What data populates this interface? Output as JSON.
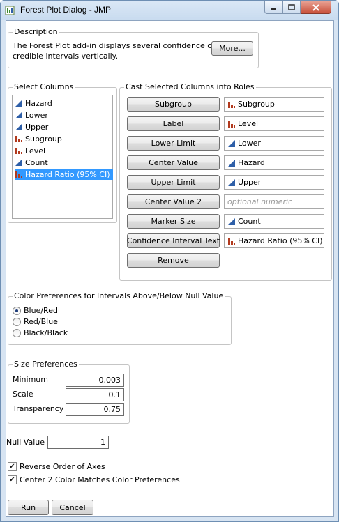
{
  "window": {
    "title": "Forest Plot Dialog - JMP"
  },
  "description": {
    "legend": "Description",
    "text_line1": "The Forest Plot add-in displays several confidence or",
    "text_line2": "credible intervals vertically.",
    "more_label": "More..."
  },
  "select_columns": {
    "legend": "Select Columns",
    "items": [
      {
        "label": "Hazard",
        "type": "continuous"
      },
      {
        "label": "Lower",
        "type": "continuous"
      },
      {
        "label": "Upper",
        "type": "continuous"
      },
      {
        "label": "Subgroup",
        "type": "nominal"
      },
      {
        "label": "Level",
        "type": "nominal"
      },
      {
        "label": "Count",
        "type": "continuous"
      },
      {
        "label": "Hazard Ratio (95% CI)",
        "type": "nominal",
        "selected": true
      }
    ]
  },
  "cast": {
    "legend": "Cast Selected Columns into Roles",
    "roles": [
      {
        "button": "Subgroup",
        "value": "Subgroup",
        "type": "nominal"
      },
      {
        "button": "Label",
        "value": "Level",
        "type": "nominal"
      },
      {
        "button": "Lower Limit",
        "value": "Lower",
        "type": "continuous"
      },
      {
        "button": "Center Value",
        "value": "Hazard",
        "type": "continuous"
      },
      {
        "button": "Upper Limit",
        "value": "Upper",
        "type": "continuous"
      },
      {
        "button": "Center Value 2",
        "value": "",
        "placeholder": "optional numeric",
        "type": "none"
      },
      {
        "button": "Marker Size",
        "value": "Count",
        "type": "continuous"
      },
      {
        "button": "Confidence Interval Text",
        "value": "Hazard Ratio (95% CI)",
        "type": "nominal"
      }
    ],
    "remove_label": "Remove"
  },
  "color_prefs": {
    "legend": "Color Preferences for Intervals Above/Below Null Value",
    "options": [
      {
        "label": "Blue/Red",
        "checked": true
      },
      {
        "label": "Red/Blue",
        "checked": false
      },
      {
        "label": "Black/Black",
        "checked": false
      }
    ]
  },
  "size_prefs": {
    "legend": "Size Preferences",
    "minimum_label": "Minimum",
    "minimum_value": "0.003",
    "scale_label": "Scale",
    "scale_value": "0.1",
    "transparency_label": "Transparency",
    "transparency_value": "0.75"
  },
  "null_value": {
    "label": "Null Value",
    "value": "1"
  },
  "checkboxes": [
    {
      "label": "Reverse Order of Axes",
      "checked": true
    },
    {
      "label": "Center 2 Color Matches Color Preferences",
      "checked": true
    }
  ],
  "actions": {
    "run_label": "Run",
    "cancel_label": "Cancel"
  },
  "colors": {
    "continuous_icon": "#2e5fa8",
    "nominal_icon": "#b23a1e",
    "selection": "#3399ff"
  }
}
